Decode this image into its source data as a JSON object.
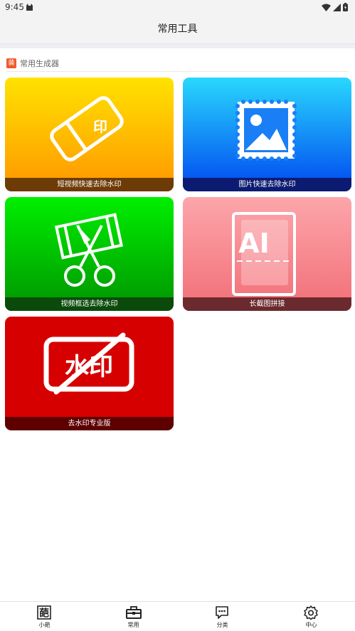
{
  "status_bar": {
    "time": "9:45"
  },
  "header": {
    "title": "常用工具"
  },
  "section": {
    "badge": "装",
    "title": "常用生成器"
  },
  "cards": [
    {
      "label": "短视频快速去除水印",
      "icon_text": "印",
      "icon": "eraser-icon",
      "colors": [
        "#ffe200",
        "#ff9600"
      ]
    },
    {
      "label": "图片快速去除水印",
      "icon": "image-stamp-icon",
      "colors": [
        "#29d8fd",
        "#0047f0"
      ]
    },
    {
      "label": "视频框选去除水印",
      "icon": "film-scissors-icon",
      "colors": [
        "#00ef00",
        "#009400"
      ]
    },
    {
      "label": "长截图拼接",
      "icon_text": "AI",
      "icon": "long-screenshot-icon",
      "colors": [
        "#fca6ab",
        "#f26e77"
      ]
    },
    {
      "label": "去水印专业版",
      "icon_text": "水印",
      "icon": "no-watermark-icon",
      "colors": [
        "#d60000",
        "#d60000"
      ]
    }
  ],
  "tabbar": {
    "items": [
      {
        "label": "小葩",
        "icon": "pa-icon",
        "icon_text": "葩"
      },
      {
        "label": "常用",
        "icon": "toolbox-icon"
      },
      {
        "label": "分类",
        "icon": "chat-icon"
      },
      {
        "label": "中心",
        "icon": "gear-icon"
      }
    ]
  }
}
